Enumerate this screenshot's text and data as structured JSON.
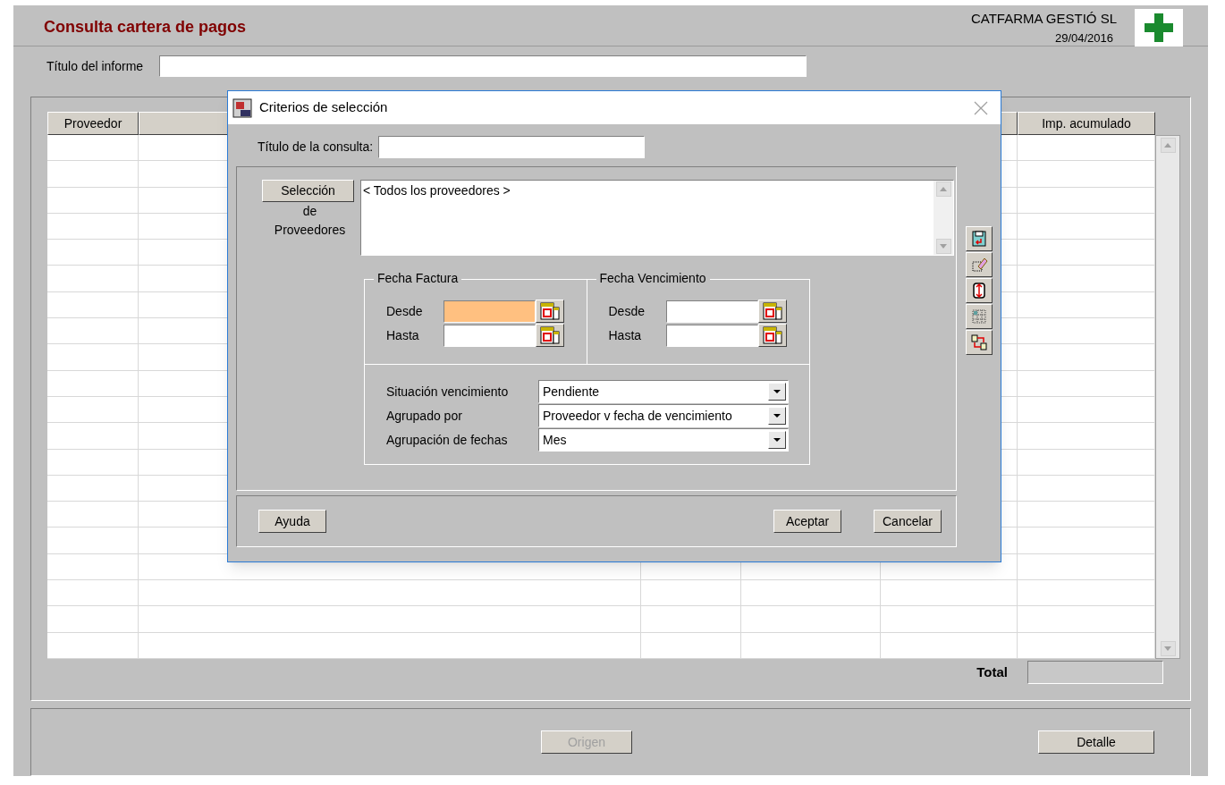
{
  "header": {
    "title": "Consulta cartera de pagos",
    "company": "CATFARMA GESTIÓ SL",
    "date": "29/04/2016"
  },
  "report_title": {
    "label": "Título del informe"
  },
  "table": {
    "columns": [
      {
        "label": "Proveedor"
      },
      {
        "label": "Imp. acumulado"
      }
    ]
  },
  "total": {
    "label": "Total"
  },
  "buttons": [
    {
      "label": "Origen",
      "disabled": true
    },
    {
      "label": "Detalle",
      "disabled": false
    }
  ],
  "dialog": {
    "title": "Criterios de selección",
    "query_title_label": "Título de la consulta:",
    "supplier_button": "Selección",
    "supplier_caption": "de Proveedores",
    "supplier_list": [
      "< Todos los proveedores >"
    ],
    "date_groups": [
      {
        "title": "Fecha Factura",
        "fields": [
          {
            "label": "Desde",
            "focused": true
          },
          {
            "label": "Hasta",
            "focused": false
          }
        ]
      },
      {
        "title": "Fecha Vencimiento",
        "fields": [
          {
            "label": "Desde",
            "focused": false
          },
          {
            "label": "Hasta",
            "focused": false
          }
        ]
      }
    ],
    "selects": [
      {
        "label": "Situación vencimiento",
        "value": "Pendiente"
      },
      {
        "label": "Agrupado por",
        "value": "Proveedor v fecha de vencimiento"
      },
      {
        "label": "Agrupación de fechas",
        "value": "Mes"
      }
    ],
    "buttons": [
      {
        "label": "Ayuda"
      },
      {
        "label": "Aceptar"
      },
      {
        "label": "Cancelar"
      }
    ]
  }
}
